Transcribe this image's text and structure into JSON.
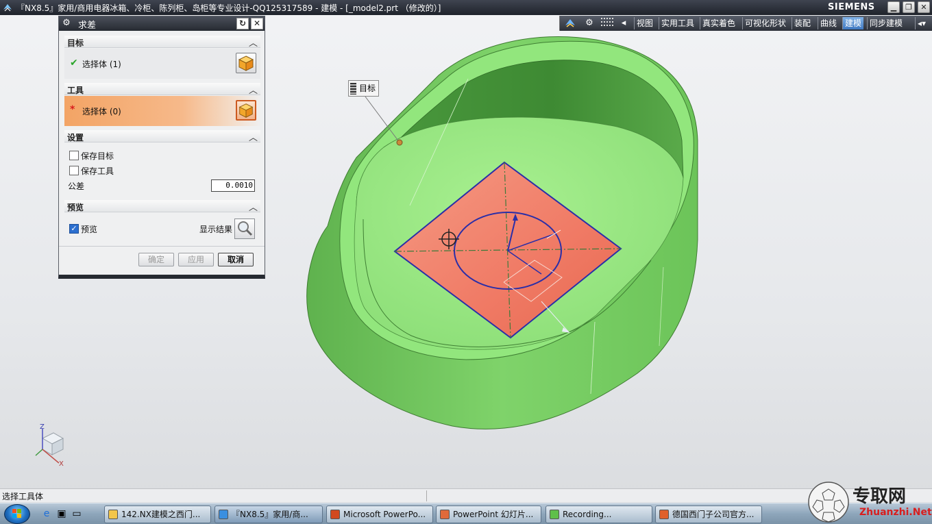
{
  "window": {
    "title": "『NX8.5』家用/商用电器冰箱、冷柜、陈列柜、岛柜等专业设计-QQ125317589 - 建模 - [_model2.prt （修改的）]",
    "brand": "SIEMENS",
    "min": "▁",
    "max": "❐",
    "close": "✕"
  },
  "toolbar": {
    "icons": [
      "nx-logo-icon",
      "gear-icon",
      "grid-icon",
      "chevron-left-icon"
    ],
    "tabs": [
      "视图",
      "实用工具",
      "真实着色",
      "可视化形状",
      "装配",
      "曲线",
      "建模",
      "同步建模"
    ],
    "active_tab": "建模",
    "more": "◂▾"
  },
  "dialog": {
    "title": "求差",
    "sections": {
      "target": {
        "header": "目标",
        "select_label": "选择体 (1)",
        "mark": "✔"
      },
      "tool": {
        "header": "工具",
        "select_label": "选择体 (0)",
        "mark": "*"
      },
      "settings": {
        "header": "设置",
        "keep_target": "保存目标",
        "keep_tool": "保存工具",
        "tolerance_label": "公差",
        "tolerance_value": "0.0010"
      },
      "preview": {
        "header": "预览",
        "preview_label": "预览",
        "preview_checked": true,
        "show_result": "显示结果"
      }
    },
    "buttons": {
      "ok": "确定",
      "apply": "应用",
      "cancel": "取消"
    }
  },
  "callout": {
    "label": "目标"
  },
  "triad": {
    "z": "Z",
    "x": "X"
  },
  "status": {
    "message": "选择工具体"
  },
  "taskbar": {
    "items": [
      {
        "label": "142.NX建模之西门...",
        "active": false
      },
      {
        "label": "『NX8.5』家用/商...",
        "active": true
      },
      {
        "label": "Microsoft PowerPo...",
        "active": false
      },
      {
        "label": "PowerPoint 幻灯片...",
        "active": false
      },
      {
        "label": "Recording...",
        "active": false
      },
      {
        "label": "德国西门子公司官方...",
        "active": false
      }
    ],
    "watermark": {
      "cn": "专取网",
      "url": "Zhuanzhi.Net"
    }
  },
  "colors": {
    "model_green": "#8fe27a",
    "face_red": "#f07a65",
    "accent_blue": "#2c6fcf"
  }
}
